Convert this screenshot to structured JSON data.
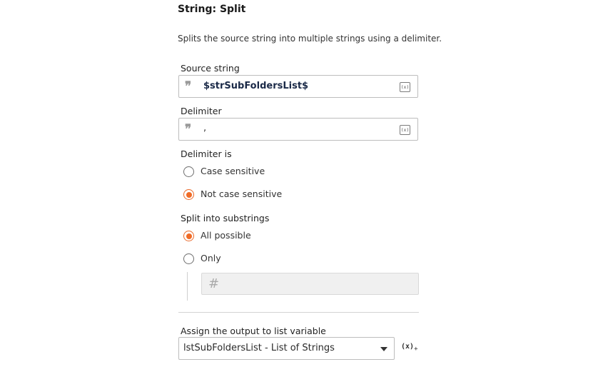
{
  "header": {
    "title": "String: Split",
    "description": "Splits the source string into multiple strings using a delimiter."
  },
  "source_string": {
    "label": "Source string",
    "value": "$strSubFoldersList$",
    "quote_glyph": "❞",
    "icon": "insert-variable-icon",
    "icon_text": "(x)"
  },
  "delimiter": {
    "label": "Delimiter",
    "value": ",",
    "quote_glyph": "❞",
    "icon": "insert-variable-icon",
    "icon_text": "(x)"
  },
  "delimiter_is": {
    "label": "Delimiter is",
    "options": [
      {
        "label": "Case sensitive",
        "selected": false
      },
      {
        "label": "Not case sensitive",
        "selected": true
      }
    ]
  },
  "split_into": {
    "label": "Split into substrings",
    "options": [
      {
        "label": "All possible",
        "selected": true
      },
      {
        "label": "Only",
        "selected": false
      }
    ],
    "count_field": {
      "value": "",
      "icon": "hash-icon",
      "glyph": "#",
      "disabled": true
    }
  },
  "output": {
    "label": "Assign the output to list variable",
    "selected_value": "lstSubFoldersList - List of Strings",
    "add_variable_icon": "add-variable-icon",
    "add_variable_text": "(x)",
    "add_variable_sub": "+"
  },
  "colors": {
    "accent": "#f06b26",
    "border": "#bdbdbd",
    "disabled_bg": "#f0f0f0"
  }
}
